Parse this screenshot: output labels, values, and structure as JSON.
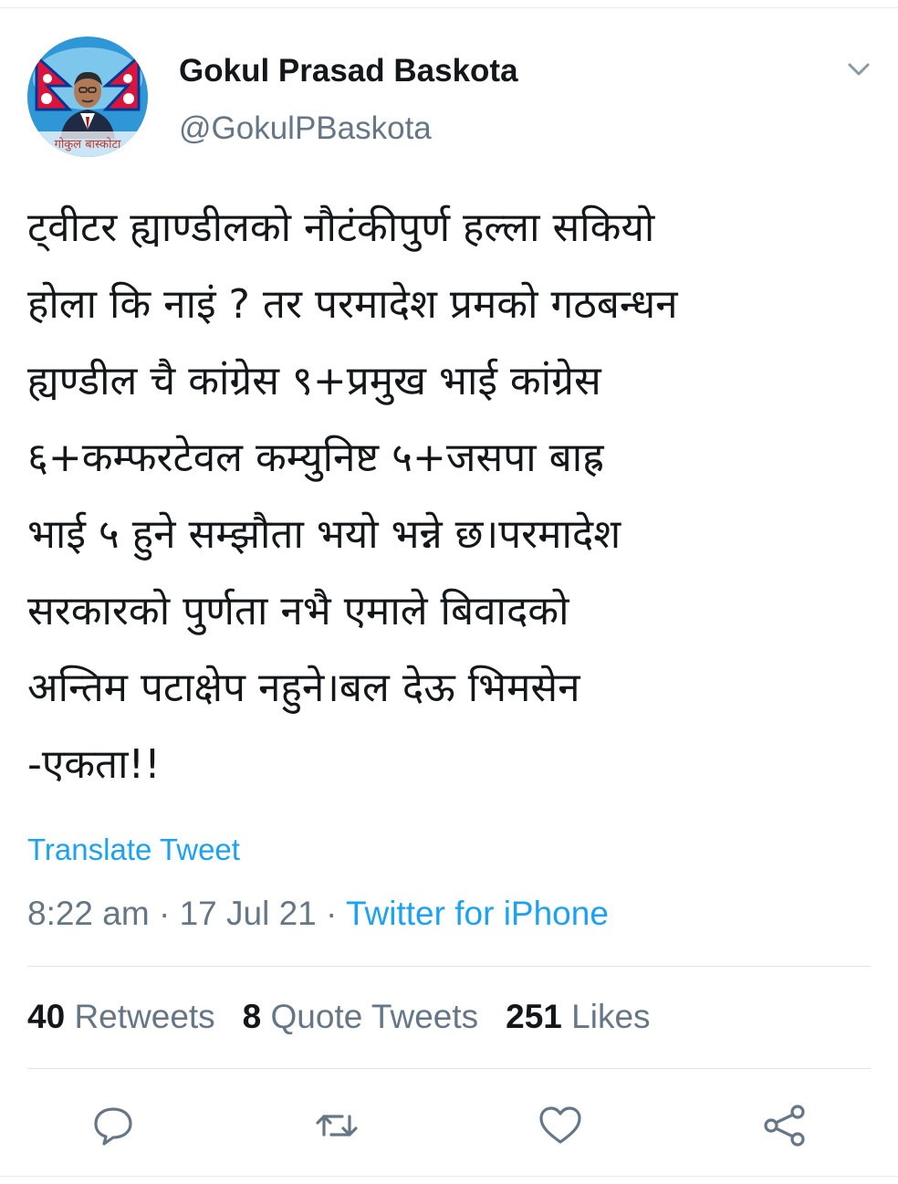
{
  "tweet": {
    "author_name": "Gokul Prasad Baskota",
    "author_handle": "@GokulPBaskota",
    "avatar_caption": "गोकुल बास्कोटा",
    "text": "ट्वीटर ह्याण्डीलको नौटंकीपुर्ण हल्ला सकियो\nहोला कि नाइं ? तर परमादेश प्रमको गठबन्धन\nह्यण्डील चै कांग्रेस ९+प्रमुख भाई कांग्रेस\n६+कम्फरटेवल कम्युनिष्ट ५+जसपा बाह्र\nभाई ५ हुने सम्झौता भयो भन्ने छ।परमादेश\nसरकारको पुर्णता नभै एमाले बिवादको\nअन्तिम पटाक्षेप नहुने।बल देऊ भिमसेन\n-एकता!!",
    "translate_label": "Translate Tweet",
    "time": "8:22 am",
    "date": "17 Jul 21",
    "separator": "·",
    "source": "Twitter for iPhone"
  },
  "stats": {
    "retweets_count": "40",
    "retweets_label": "Retweets",
    "quotes_count": "8",
    "quotes_label": "Quote Tweets",
    "likes_count": "251",
    "likes_label": "Likes"
  },
  "icons": {
    "menu": "chevron-down-icon",
    "reply": "reply-icon",
    "retweet": "retweet-icon",
    "like": "heart-icon",
    "share": "share-icon"
  },
  "colors": {
    "accent": "#1da1f2",
    "secondary_text": "#657786",
    "primary_text": "#14171a",
    "divider": "#dfe5ea"
  }
}
